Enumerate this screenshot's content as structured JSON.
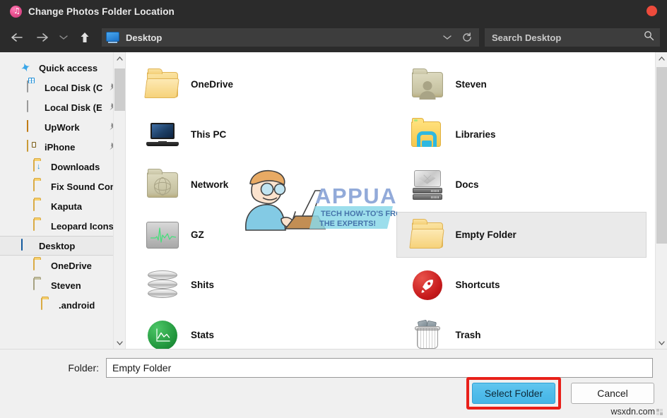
{
  "window": {
    "title": "Change Photos Folder Location",
    "app_icon": "itunes-music-note-icon",
    "close_label": "×"
  },
  "nav": {
    "back": "back-arrow",
    "forward": "forward-arrow",
    "recent": "recent-locations-dropdown",
    "up": "up-arrow",
    "address_value": "Desktop",
    "address_icon": "desktop-monitor-icon",
    "dropdown": "address-dropdown",
    "refresh": "refresh-icon"
  },
  "search": {
    "placeholder": "Search Desktop",
    "value": "",
    "icon": "search-icon"
  },
  "sidebar": {
    "items": [
      {
        "label": "Quick access",
        "icon": "quick-access-star-icon",
        "level": 0,
        "pinned": false,
        "selected": false
      },
      {
        "label": "Local Disk (C",
        "icon": "windows-drive-icon",
        "level": 1,
        "pinned": true,
        "selected": false
      },
      {
        "label": "Local Disk (E",
        "icon": "drive-icon",
        "level": 1,
        "pinned": true,
        "selected": false
      },
      {
        "label": "UpWork",
        "icon": "orange-drive-icon",
        "level": 1,
        "pinned": true,
        "selected": false
      },
      {
        "label": "iPhone",
        "icon": "usb-drive-icon",
        "level": 1,
        "pinned": true,
        "selected": false
      },
      {
        "label": "Downloads",
        "icon": "downloads-folder-icon",
        "level": 1,
        "pinned": false,
        "selected": false
      },
      {
        "label": "Fix Sound Comi",
        "icon": "folder-icon",
        "level": 1,
        "pinned": false,
        "selected": false
      },
      {
        "label": "Kaputa",
        "icon": "folder-icon",
        "level": 1,
        "pinned": false,
        "selected": false
      },
      {
        "label": "Leopard Icons",
        "icon": "folder-icon",
        "level": 1,
        "pinned": false,
        "selected": false
      },
      {
        "label": "Desktop",
        "icon": "desktop-monitor-icon",
        "level": 0,
        "pinned": false,
        "selected": true
      },
      {
        "label": "OneDrive",
        "icon": "folder-icon",
        "level": 1,
        "pinned": false,
        "selected": false
      },
      {
        "label": "Steven",
        "icon": "user-folder-icon",
        "level": 1,
        "pinned": false,
        "selected": false
      },
      {
        "label": ".android",
        "icon": "folder-icon",
        "level": 2,
        "pinned": false,
        "selected": false
      }
    ]
  },
  "files": {
    "items": [
      {
        "label": "OneDrive",
        "icon": "open-folder-icon",
        "selected": false
      },
      {
        "label": "Steven",
        "icon": "user-folder-icon",
        "selected": false
      },
      {
        "label": "This PC",
        "icon": "laptop-icon",
        "selected": false
      },
      {
        "label": "Libraries",
        "icon": "libraries-folder-icon",
        "selected": false
      },
      {
        "label": "Network",
        "icon": "network-folder-icon",
        "selected": false
      },
      {
        "label": "Docs",
        "icon": "hard-drive-icon",
        "selected": false
      },
      {
        "label": "GZ",
        "icon": "monitor-ekg-icon",
        "selected": false
      },
      {
        "label": "Empty Folder",
        "icon": "open-folder-icon",
        "selected": true
      },
      {
        "label": "Shits",
        "icon": "disk-stack-icon",
        "selected": false
      },
      {
        "label": "Shortcuts",
        "icon": "rocket-icon",
        "selected": false
      },
      {
        "label": "Stats",
        "icon": "green-chart-icon",
        "selected": false
      },
      {
        "label": "Trash",
        "icon": "trash-can-icon",
        "selected": false
      }
    ]
  },
  "watermark": {
    "brand": "APPUALS",
    "tagline_line1": "TECH HOW-TO'S FROM",
    "tagline_line2": "THE EXPERTS!",
    "site": "wsxdn.com"
  },
  "bottom": {
    "folder_label": "Folder:",
    "folder_value": "Empty Folder",
    "select_label": "Select Folder",
    "cancel_label": "Cancel"
  },
  "colors": {
    "titlebar": "#2b2b2b",
    "close": "#ee4b3c",
    "primary_button": "#4fbcea",
    "highlight_box": "#e8201a",
    "selection": "#eaeaea"
  }
}
